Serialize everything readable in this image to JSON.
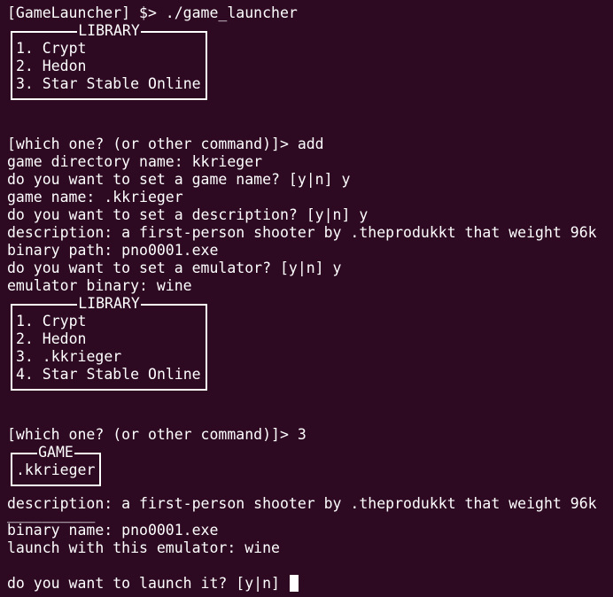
{
  "terminal": {
    "lines_top": [
      "[GameLauncher] $> ./game_launcher"
    ],
    "library_title": "LIBRARY",
    "library_items_1": [
      "1. Crypt",
      "2. Hedon",
      "3. Star Stable Online"
    ],
    "session_1": [
      "[which one? (or other command)]> add",
      "game directory name: kkrieger",
      "do you want to set a game name? [y|n] y",
      "game name: .kkrieger",
      "do you want to set a description? [y|n] y",
      "description: a first-person shooter by .theprodukkt that weight 96k",
      "binary path: pno0001.exe",
      "do you want to set a emulator? [y|n] y",
      "emulator binary: wine"
    ],
    "library_items_2": [
      "1. Crypt",
      "2. Hedon",
      "3. .kkrieger",
      "4. Star Stable Online"
    ],
    "select_prompt": "[which one? (or other command)]> 3",
    "game_title": "GAME",
    "game_name": ".kkrieger",
    "game_info": [
      "description: a first-person shooter by .theprodukkt that weight 96k",
      "__________",
      "binary name: pno0001.exe",
      "launch with this emulator: wine"
    ],
    "launch_prompt": "do you want to launch it? [y|n] "
  }
}
